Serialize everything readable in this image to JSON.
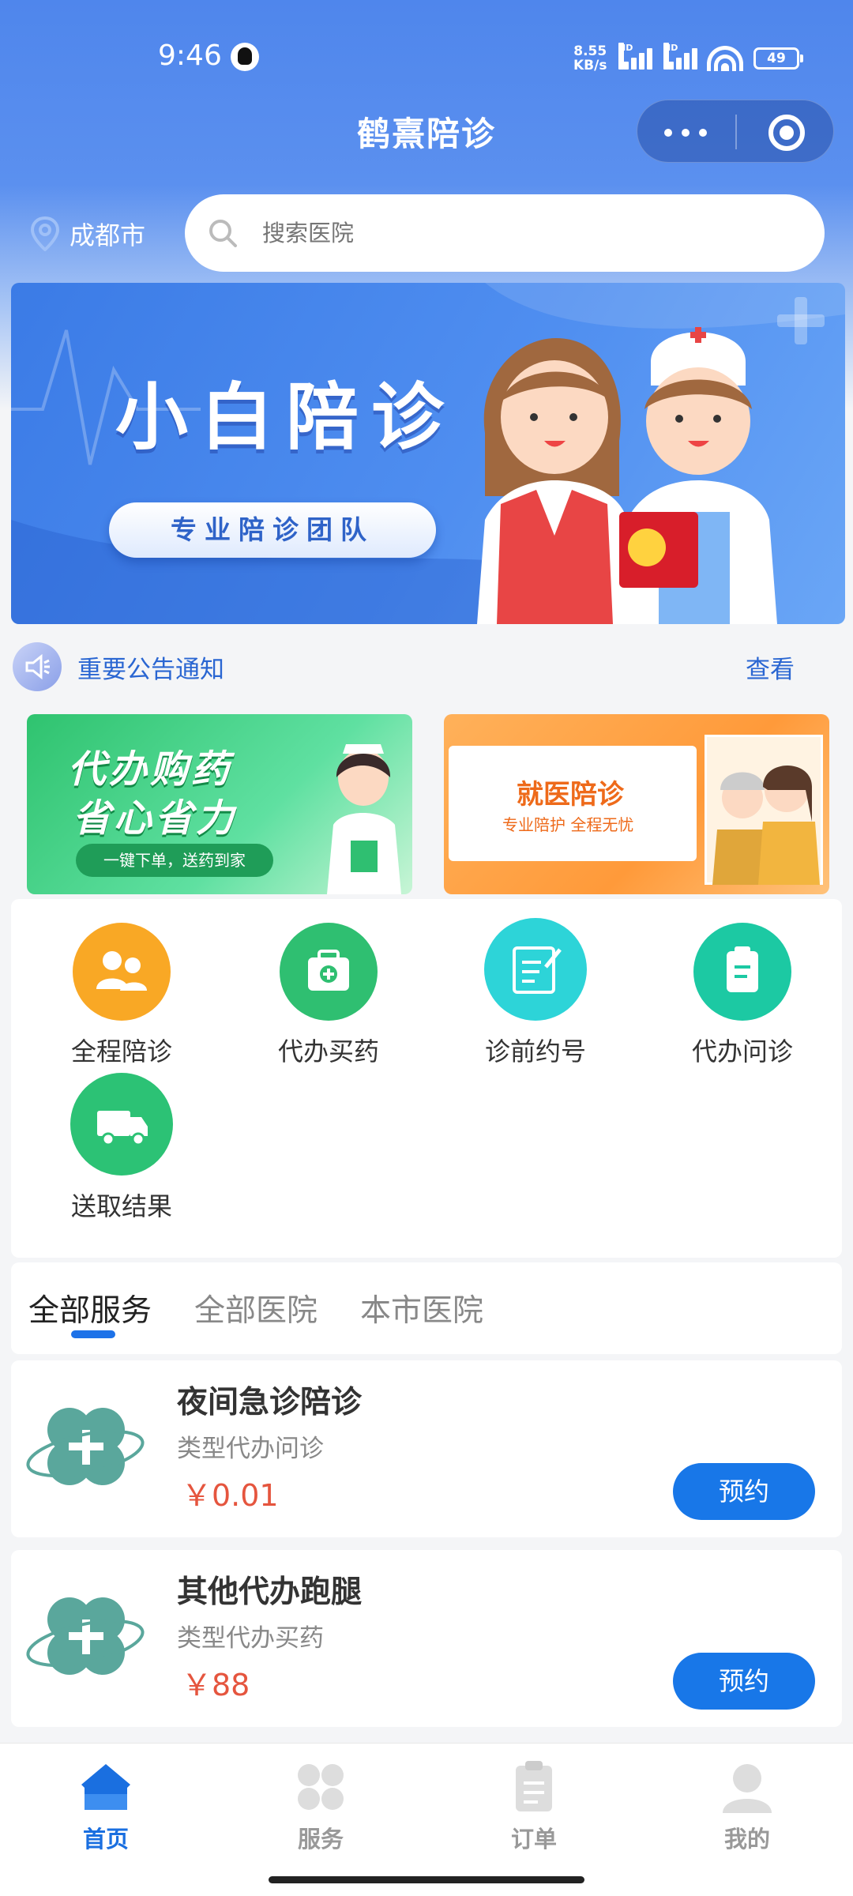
{
  "status_bar": {
    "time": "9:46",
    "net_speed_value": "8.55",
    "net_speed_unit": "KB/s",
    "signal_1_label": "HD",
    "signal_2_label": "HD",
    "battery": "49"
  },
  "nav": {
    "title": "鹤熹陪诊"
  },
  "location": {
    "city": "成都市"
  },
  "search": {
    "placeholder": "搜索医院"
  },
  "banner": {
    "title": "小白陪诊",
    "subtitle": "专业陪诊团队"
  },
  "notice": {
    "text": "重要公告通知",
    "link": "查看"
  },
  "promos": [
    {
      "line1": "代办购药",
      "line2": "省心省力",
      "line3": "一键下单，送药到家"
    },
    {
      "line1": "就医陪诊",
      "line2": "专业陪护 全程无忧"
    }
  ],
  "services_grid": [
    {
      "label": "全程陪诊",
      "color": "#f9a825",
      "icon": "people-icon"
    },
    {
      "label": "代办买药",
      "color": "#2fbf71",
      "icon": "medicine-kit-icon"
    },
    {
      "label": "诊前约号",
      "color": "#2dd4d8",
      "icon": "edit-note-icon"
    },
    {
      "label": "代办问诊",
      "color": "#1cc9a3",
      "icon": "clipboard-icon"
    },
    {
      "label": "送取结果",
      "color": "#2cc275",
      "icon": "truck-icon"
    }
  ],
  "tabs": [
    "全部服务",
    "全部医院",
    "本市医院"
  ],
  "service_list": [
    {
      "name": "夜间急诊陪诊",
      "type": "类型代办问诊",
      "price": "￥0.01",
      "button": "预约"
    },
    {
      "name": "其他代办跑腿",
      "type": "类型代办买药",
      "price": "￥88",
      "button": "预约"
    }
  ],
  "tabbar": [
    {
      "label": "首页",
      "icon": "home-icon",
      "active": true
    },
    {
      "label": "服务",
      "icon": "grid-icon",
      "active": false
    },
    {
      "label": "订单",
      "icon": "order-icon",
      "active": false
    },
    {
      "label": "我的",
      "icon": "user-icon",
      "active": false
    }
  ],
  "colors": {
    "primary": "#1877e8",
    "header_blue": "#4f86ec",
    "price_red": "#e5553e"
  }
}
